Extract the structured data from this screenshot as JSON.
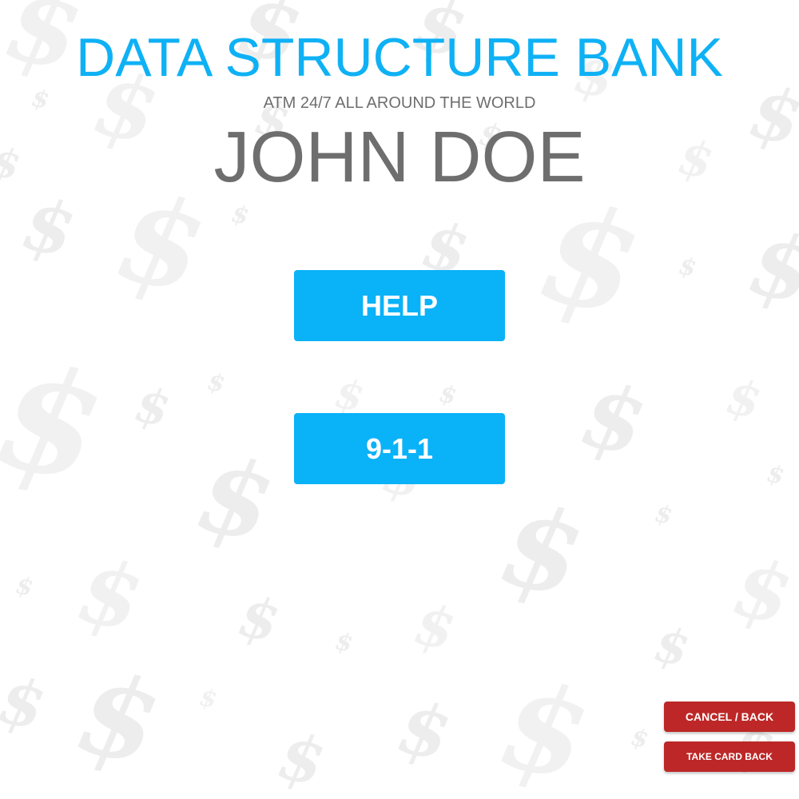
{
  "header": {
    "bank_name": "DATA STRUCTURE BANK",
    "tagline": "ATM 24/7 ALL AROUND THE WORLD",
    "customer_name": "JOHN DOE"
  },
  "actions": {
    "help_label": "HELP",
    "emergency_label": "9-1-1"
  },
  "footer_actions": {
    "cancel_back_label": "CANCEL / BACK",
    "take_card_back_label": "TAKE CARD BACK"
  },
  "background": {
    "watermark_icon": "dollar-sign-icon",
    "watermark_glyph": "$"
  },
  "colors": {
    "brand": "#0fb1f5",
    "primary_button": "#0ab2f8",
    "danger_button": "#bd2727",
    "text_gray": "#6e6e6e"
  }
}
